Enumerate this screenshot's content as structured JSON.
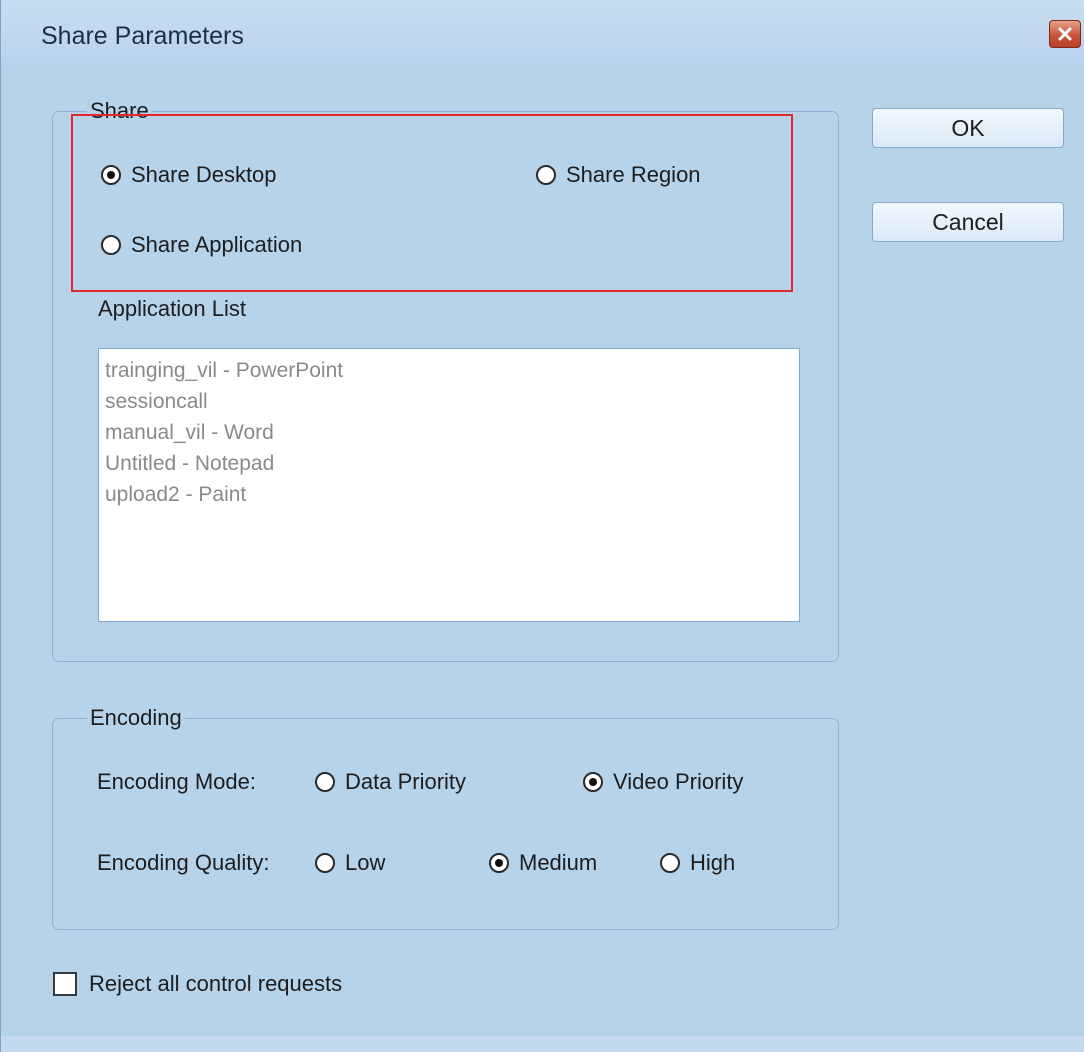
{
  "window": {
    "title": "Share Parameters",
    "close_icon": "close-icon"
  },
  "share_group": {
    "legend": "Share",
    "options": {
      "desktop": "Share Desktop",
      "region": "Share Region",
      "application": "Share Application"
    },
    "selected": "desktop",
    "application_list_label": "Application List",
    "applications": [
      "trainging_vil - PowerPoint",
      "sessioncall",
      "manual_vil - Word",
      "Untitled - Notepad",
      "upload2 - Paint"
    ]
  },
  "encoding_group": {
    "legend": "Encoding",
    "mode_label": "Encoding Mode:",
    "mode_options": {
      "data_priority": "Data Priority",
      "video_priority": "Video Priority"
    },
    "mode_selected": "video_priority",
    "quality_label": "Encoding Quality:",
    "quality_options": {
      "low": "Low",
      "medium": "Medium",
      "high": "High"
    },
    "quality_selected": "medium"
  },
  "reject_control": {
    "label": "Reject all control requests",
    "checked": false
  },
  "buttons": {
    "ok": "OK",
    "cancel": "Cancel"
  },
  "colors": {
    "dialog_bg": "#b7d3ea",
    "highlight": "#e5262b",
    "list_text": "#8a8a8a"
  }
}
